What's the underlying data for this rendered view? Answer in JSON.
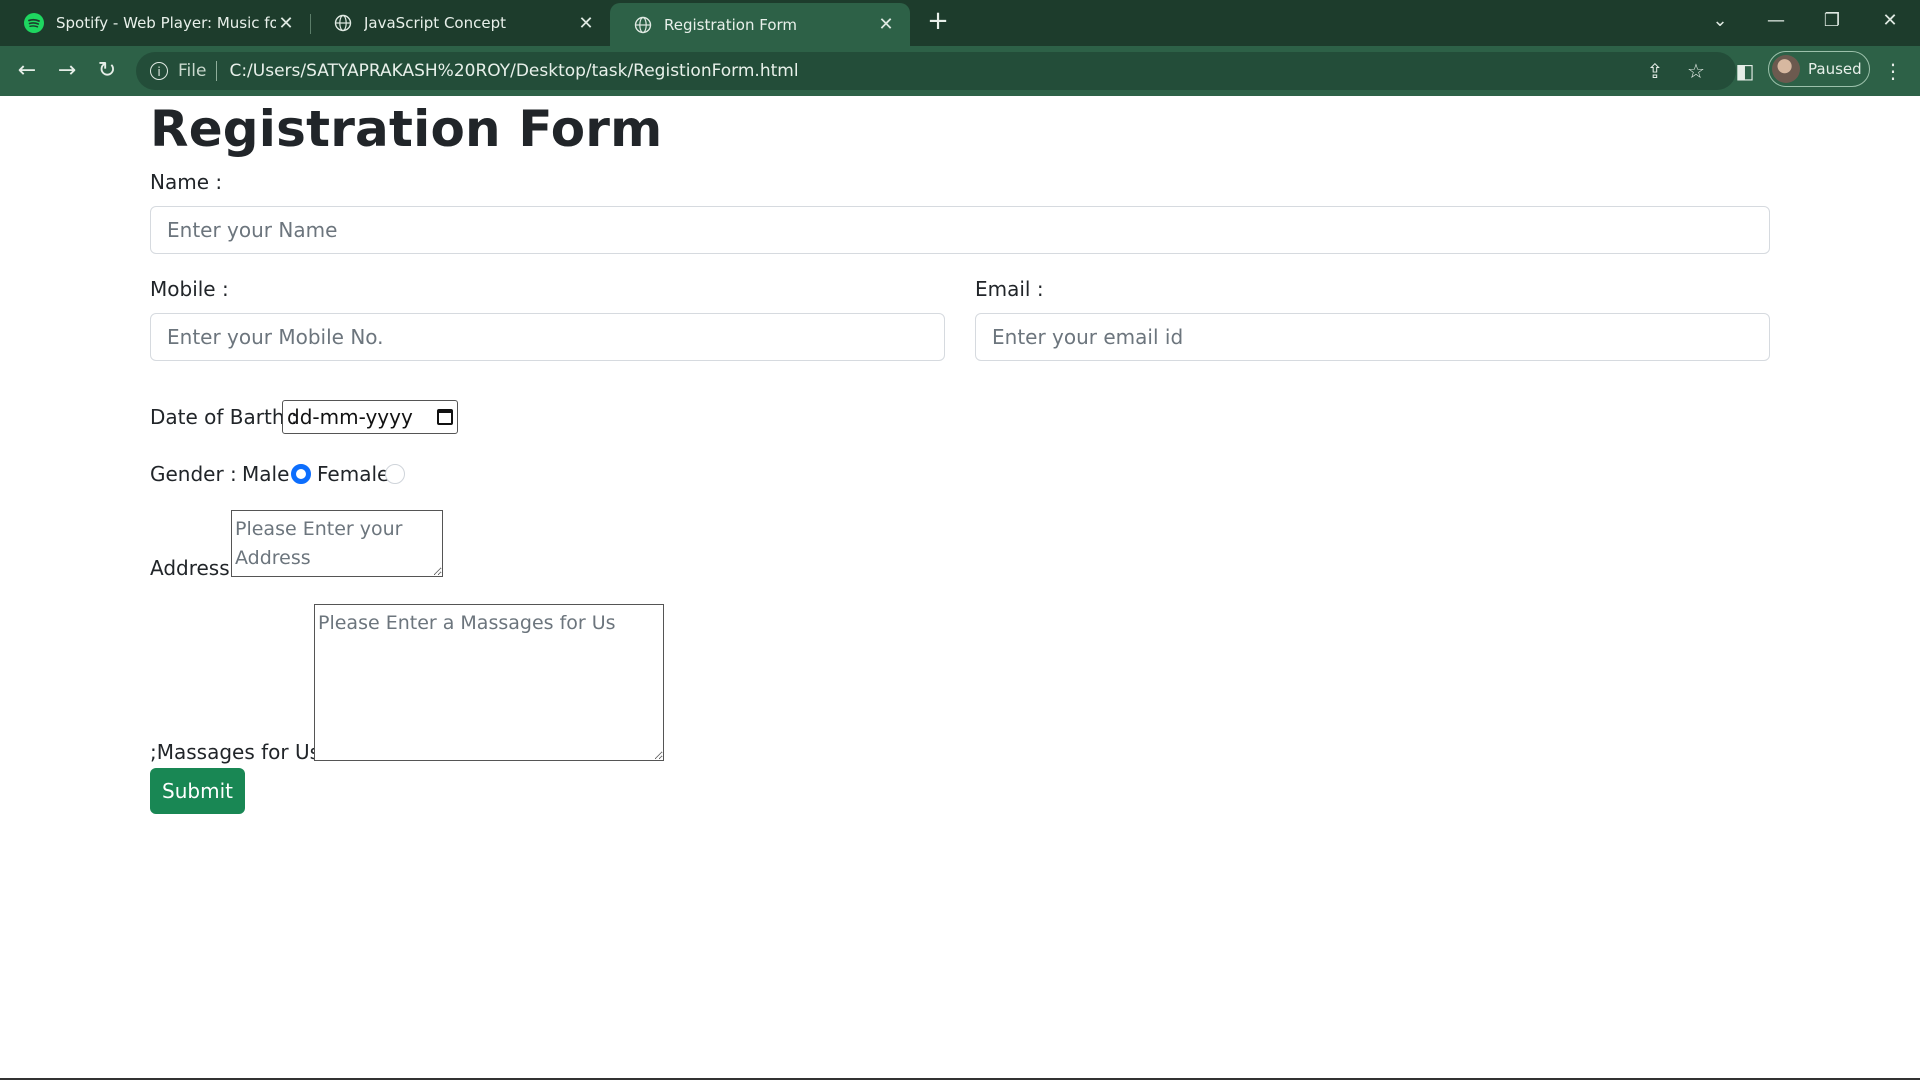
{
  "browser": {
    "tabs": [
      {
        "label": "Spotify - Web Player: Music for e",
        "icon": "spotify-icon"
      },
      {
        "label": "JavaScript Concept",
        "icon": "globe-icon"
      },
      {
        "label": "Registration Form",
        "icon": "globe-icon",
        "active": true
      }
    ],
    "address": {
      "scheme": "File",
      "url": "C:/Users/SATYAPRAKASH%20ROY/Desktop/task/RegistionForm.html"
    },
    "profile": {
      "status": "Paused"
    }
  },
  "form": {
    "title": "Registration Form",
    "name": {
      "label": "Name :",
      "placeholder": "Enter your Name"
    },
    "mobile": {
      "label": "Mobile :",
      "placeholder": "Enter your Mobile No."
    },
    "email": {
      "label": "Email :",
      "placeholder": "Enter your email id"
    },
    "dob": {
      "label": "Date of Barth :",
      "value": "dd-mm-yyyy"
    },
    "gender": {
      "label": "Gender :",
      "options": [
        "Male",
        "Female"
      ],
      "selected": "Male"
    },
    "address": {
      "label": "Address:",
      "placeholder": "Please Enter your Address"
    },
    "message": {
      "label": ";Massages for Us :",
      "placeholder": "Please Enter a Massages for Us"
    },
    "submit_label": "Submit"
  },
  "colors": {
    "chrome_tabbar": "#1d3c2c",
    "chrome_toolbar": "#2d6147",
    "primary": "#0d6efd",
    "success": "#198754"
  }
}
